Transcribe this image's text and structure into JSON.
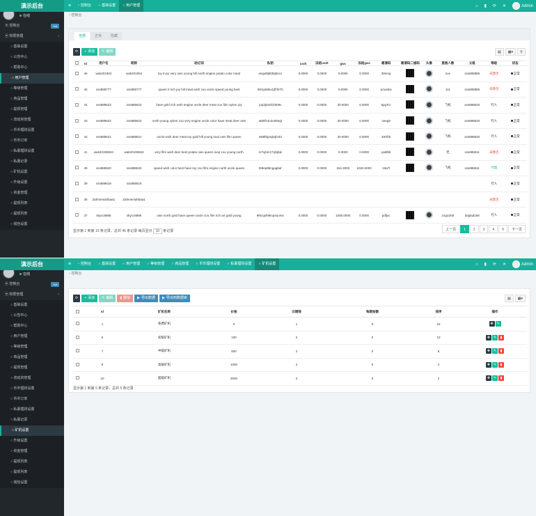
{
  "app": {
    "title": "演示后台",
    "admin": "Admin"
  },
  "screen1": {
    "tabs": [
      "控制台",
      "基础设置",
      "用户管理"
    ],
    "active_tab": 2,
    "sidebar": {
      "online": "在线",
      "items": [
        {
          "label": "控制台",
          "badge": "hot"
        },
        {
          "label": "权限管理",
          "chevron": "‹"
        },
        {
          "label": "基础设置",
          "sub": true
        },
        {
          "label": "公告中心",
          "sub": true
        },
        {
          "label": "帮助中心",
          "sub": true
        },
        {
          "label": "用户管理",
          "sub": true,
          "active": true
        },
        {
          "label": "等级管理",
          "sub": true
        },
        {
          "label": "商品管理",
          "sub": true
        },
        {
          "label": "提现管理",
          "sub": true
        },
        {
          "label": "流动资管理",
          "sub": true
        },
        {
          "label": "币币理财设置",
          "sub": true
        },
        {
          "label": "币币订单",
          "sub": true
        },
        {
          "label": "私募理财设置",
          "sub": true
        },
        {
          "label": "私募记录",
          "sub": true
        },
        {
          "label": "矿机设置",
          "sub": true
        },
        {
          "label": "升级设置",
          "sub": true
        },
        {
          "label": "资金管理",
          "sub": true
        },
        {
          "label": "提现列表",
          "sub": true
        },
        {
          "label": "提现列表",
          "sub": true
        },
        {
          "label": "钱包设置",
          "sub": true
        }
      ]
    },
    "breadcrumb": "控制台",
    "panel_tabs": [
      "全部",
      "正常",
      "隐藏"
    ],
    "toolbar": {
      "add": "添加",
      "edit": "编辑"
    },
    "columns": [
      "Id",
      "用户名",
      "昵称",
      "助记词",
      "私钥",
      "usdt",
      "冻结usdt",
      "gwc",
      "冻结gwc",
      "邀请码",
      "邀请码二维码",
      "头像",
      "直推人数",
      "父级",
      "等级",
      "状态"
    ],
    "rows": [
      [
        "46",
        "wak201904",
        "wak201904",
        "toy it joy very own young hill north engine potato color meat",
        "angul8j9t3bjbncv",
        "0.0000",
        "0.0000",
        "0.0000",
        "0.0000",
        "39nmg",
        "qr",
        "av",
        "sox",
        "sss888886",
        "未激活",
        "正常"
      ],
      [
        "45",
        "sss888777",
        "sss888777",
        "queen it rich joy hill meat wish zoo uncle speed young best",
        "6hi1p56kx1jfhf470",
        "0.0000",
        "0.0000",
        "0.0000",
        "0.0000",
        "pcwx6w",
        "qr",
        "av",
        "111",
        "sss888886",
        "未激活",
        "正常"
      ],
      [
        "44",
        "sss888623",
        "sss888623",
        "have gold rich wish engine uncle deer meat zoo film xylem joy",
        "jop3jkx5l1f4t09v",
        "0.0000",
        "0.0000",
        "30.0000",
        "0.0000",
        "5pgTcc",
        "qr",
        "av",
        "飞机",
        "sss888620",
        "行人",
        "正常"
      ],
      [
        "43",
        "sss888622",
        "sss888622",
        "north young xylem zoo very engine uncle color have meat deer own",
        "a8t0fc4n2u094gl",
        "0.0000",
        "0.0000",
        "30.0000",
        "0.0000",
        "seeg9",
        "qr",
        "av",
        "飞机",
        "sss888620",
        "行人",
        "正常"
      ],
      [
        "42",
        "sss888621",
        "sss888621",
        "uncle wish deer meat toy gold hill young loud own film queen",
        "s8t8f0pnqkqfv33",
        "0.0000",
        "0.0000",
        "30.0000",
        "0.0000",
        "49cfkb",
        "qr",
        "av",
        "飞机",
        "sss888620",
        "行人",
        "正常"
      ],
      [
        "41",
        "wak20190604",
        "wak20190604",
        "very film wish deer best potato own queen loop zoo young north",
        "m7ujt4cz7cjbjfqk",
        "0.0000",
        "0.0000",
        "0.0000",
        "0.0000",
        "ya6f6b",
        "qr",
        "av",
        "无",
        "sss888611",
        "未激活",
        "正常"
      ],
      [
        "40",
        "sss888620",
        "sss888620",
        "speed wish color best have toy zoo film engine north uncle queen",
        "t59ep9bngag6af",
        "0.0000",
        "0.0000",
        "264.3000",
        "1020.0000",
        "19a7l",
        "qr",
        "av",
        "飞机",
        "sss888611",
        "代理",
        "正常"
      ],
      [
        "39",
        "sss888619",
        "sss888619",
        "",
        "",
        "",
        "",
        "",
        "",
        "",
        "",
        "",
        "",
        "",
        "行人",
        "正常"
      ],
      [
        "36",
        "Zahmeniahbaa1",
        "Zahmeniahbaa1",
        "",
        "",
        "",
        "",
        "",
        "",
        "",
        "",
        "",
        "",
        "",
        "未激活",
        "正常"
      ],
      [
        "37",
        "skycc8888",
        "skycc8888",
        "own north gold have queen uncle zoo film rich air gold young",
        "9f6cqsh9knp4uoms",
        "0.0000",
        "0.0000",
        "1000.0000",
        "0.0000",
        "pdfjsc",
        "qr",
        "av",
        "zoyjx200",
        "dajdad168",
        "行人",
        "正常"
      ]
    ],
    "footer": {
      "a": "显示第 1 到第 10 条记录，总共 46 条记录 每页显示",
      "per": "10",
      "b": "条记录"
    },
    "pager": [
      "上一页",
      "1",
      "2",
      "3",
      "4",
      "5",
      "下一页"
    ]
  },
  "screen2": {
    "tabs": [
      "控制台",
      "基础设置",
      "用户管理",
      "等级管理",
      "商品管理",
      "币币理财设置",
      "私募理财设置",
      "矿机设置"
    ],
    "active_tab": 7,
    "sidebar": {
      "online": "在线",
      "items": [
        {
          "label": "控制台",
          "badge": "hot"
        },
        {
          "label": "权限管理",
          "chevron": "‹"
        },
        {
          "label": "基础设置",
          "sub": true
        },
        {
          "label": "公告中心",
          "sub": true
        },
        {
          "label": "帮助中心",
          "sub": true
        },
        {
          "label": "用户管理",
          "sub": true
        },
        {
          "label": "等级管理",
          "sub": true
        },
        {
          "label": "商品管理",
          "sub": true
        },
        {
          "label": "提现管理",
          "sub": true
        },
        {
          "label": "流动资管理",
          "sub": true
        },
        {
          "label": "币币理财设置",
          "sub": true
        },
        {
          "label": "币币订单",
          "sub": true
        },
        {
          "label": "私募理财设置",
          "sub": true
        },
        {
          "label": "私募记录",
          "sub": true
        },
        {
          "label": "矿机设置",
          "sub": true,
          "active": true
        },
        {
          "label": "升级设置",
          "sub": true
        },
        {
          "label": "资金管理",
          "sub": true
        },
        {
          "label": "提现列表",
          "sub": true
        },
        {
          "label": "提现列表",
          "sub": true
        },
        {
          "label": "钱包设置",
          "sub": true
        }
      ]
    },
    "breadcrumb": "控制台",
    "toolbar": {
      "add": "添加",
      "edit": "编辑",
      "del": "删除",
      "restore": "导出数据",
      "export": "导出到数据库"
    },
    "columns": [
      "Id",
      "矿机名称",
      "价格",
      "日期限",
      "每期金额",
      "排序",
      "操作"
    ],
    "rows": [
      [
        "1",
        "免费矿机",
        "0",
        "1",
        "5",
        "23"
      ],
      [
        "6",
        "初级矿机",
        "100",
        "2",
        "0",
        "10"
      ],
      [
        "7",
        "中级矿机",
        "500",
        "2",
        "0",
        "8"
      ],
      [
        "8",
        "高级矿机",
        "1000",
        "2",
        "0",
        "4"
      ],
      [
        "10",
        "超级矿机",
        "3000",
        "2",
        "0",
        "2"
      ]
    ],
    "footer": "显示第 1 到第 5 条记录，总共 5 条记录"
  }
}
